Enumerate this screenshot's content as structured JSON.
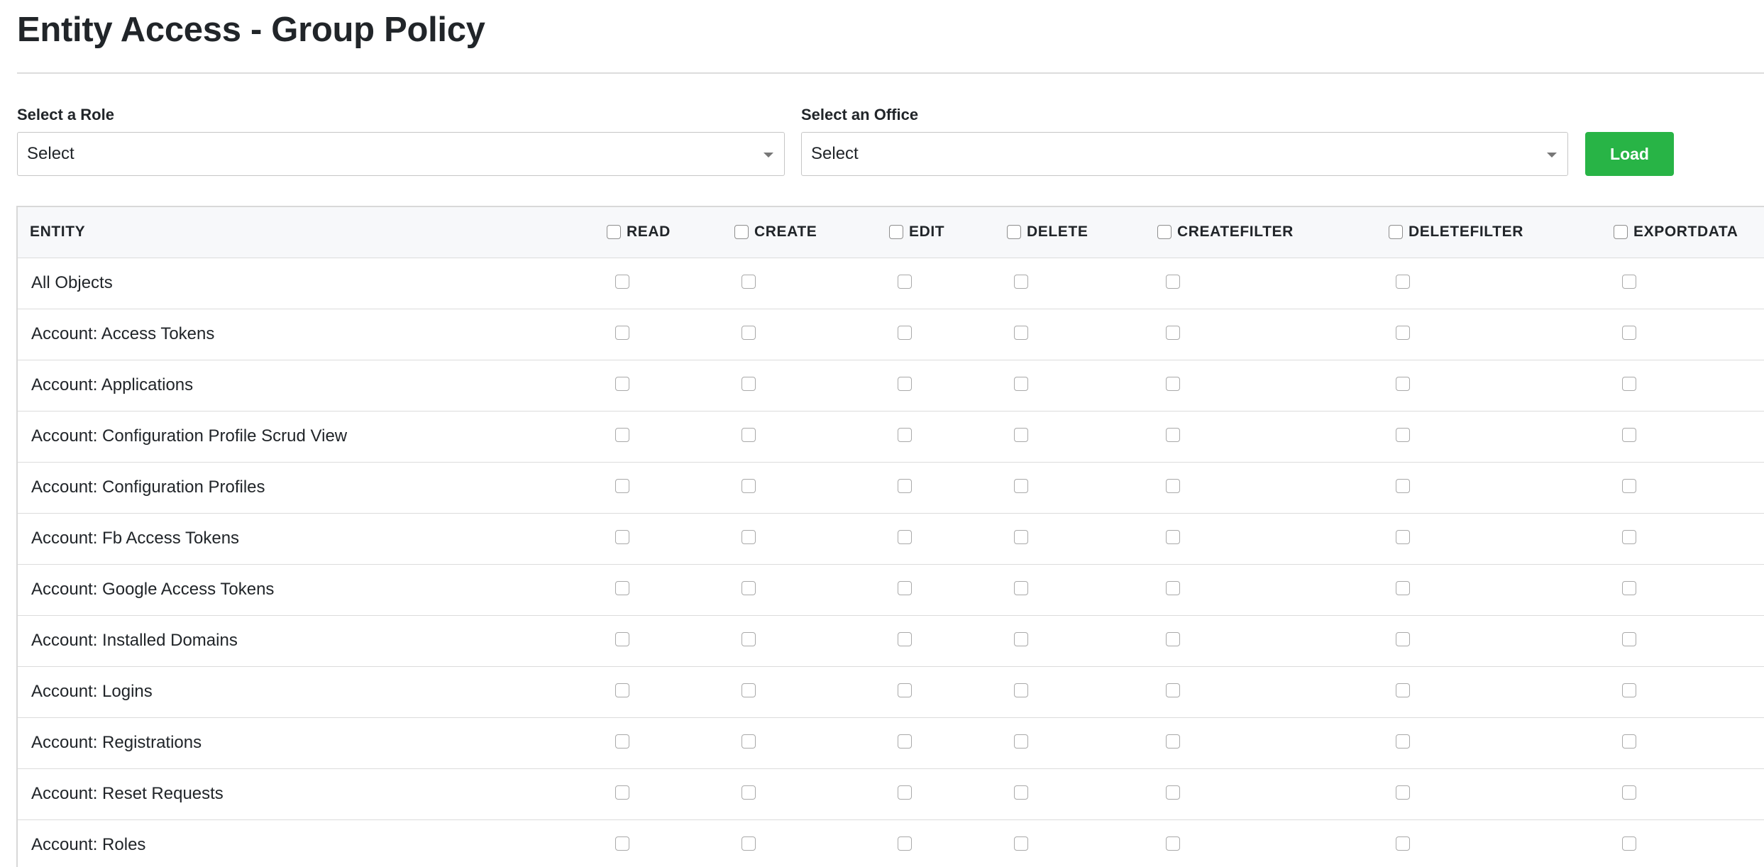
{
  "page": {
    "title": "Entity Access - Group Policy"
  },
  "filters": {
    "role": {
      "label": "Select a Role",
      "value": "Select"
    },
    "office": {
      "label": "Select an Office",
      "value": "Select"
    },
    "load_label": "Load",
    "load_color": "#28b446"
  },
  "table": {
    "entity_header": "ENTITY",
    "permission_headers": [
      "READ",
      "CREATE",
      "EDIT",
      "DELETE",
      "CREATEFILTER",
      "DELETEFILTER",
      "EXPORTDATA"
    ],
    "rows": [
      "All Objects",
      "Account: Access Tokens",
      "Account: Applications",
      "Account: Configuration Profile Scrud View",
      "Account: Configuration Profiles",
      "Account: Fb Access Tokens",
      "Account: Google Access Tokens",
      "Account: Installed Domains",
      "Account: Logins",
      "Account: Registrations",
      "Account: Reset Requests",
      "Account: Roles"
    ],
    "checked": false
  }
}
